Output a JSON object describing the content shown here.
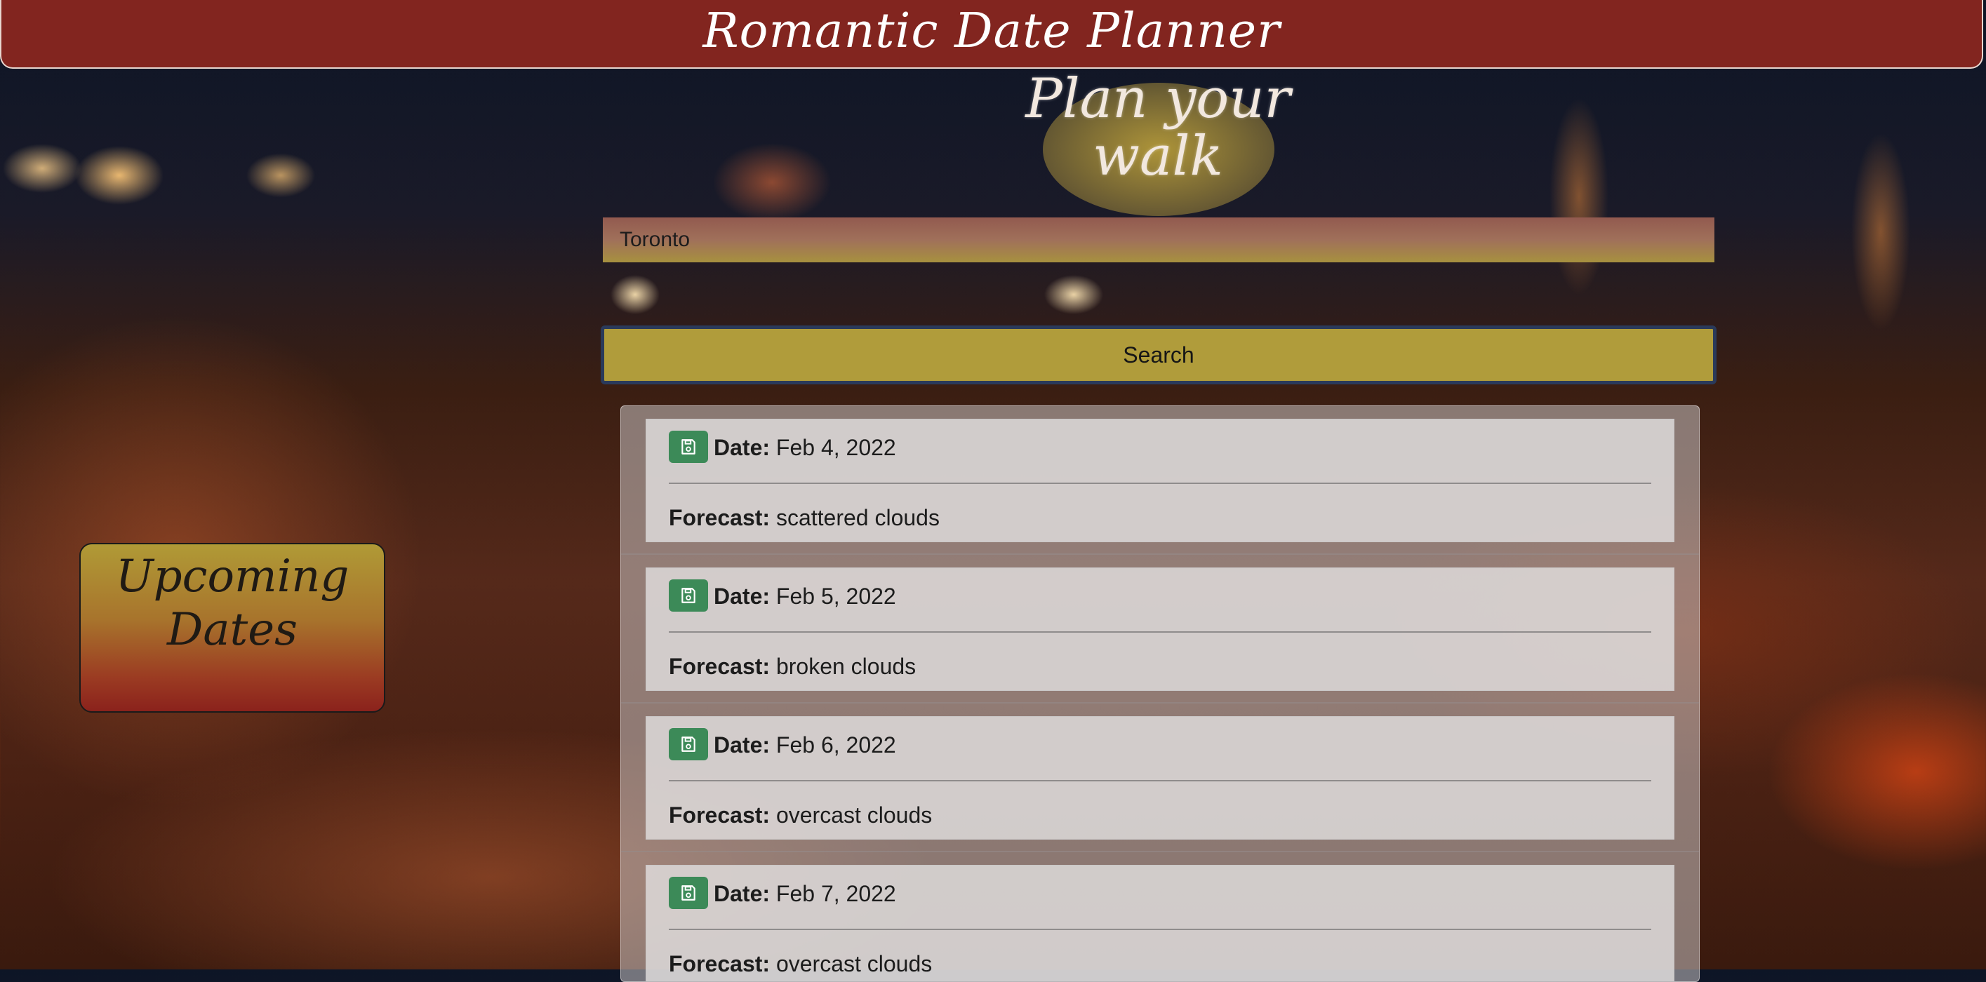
{
  "header": {
    "title": "Romantic Date Planner"
  },
  "planner": {
    "title": "Plan your walk",
    "city_input": {
      "value": "Toronto"
    },
    "search_label": "Search"
  },
  "sidebar": {
    "upcoming_title": "Upcoming Dates"
  },
  "forecast": {
    "date_label": "Date:",
    "forecast_label": "Forecast:",
    "days": [
      {
        "date": "Feb 4, 2022",
        "forecast": "scattered clouds"
      },
      {
        "date": "Feb 5, 2022",
        "forecast": "broken clouds"
      },
      {
        "date": "Feb 6, 2022",
        "forecast": "overcast clouds"
      },
      {
        "date": "Feb 7, 2022",
        "forecast": "overcast clouds"
      }
    ],
    "save_icon": "save-icon"
  },
  "colors": {
    "header_bg": "#82251f",
    "search_button": "#b09c3b",
    "save_button": "#3c8a58"
  }
}
